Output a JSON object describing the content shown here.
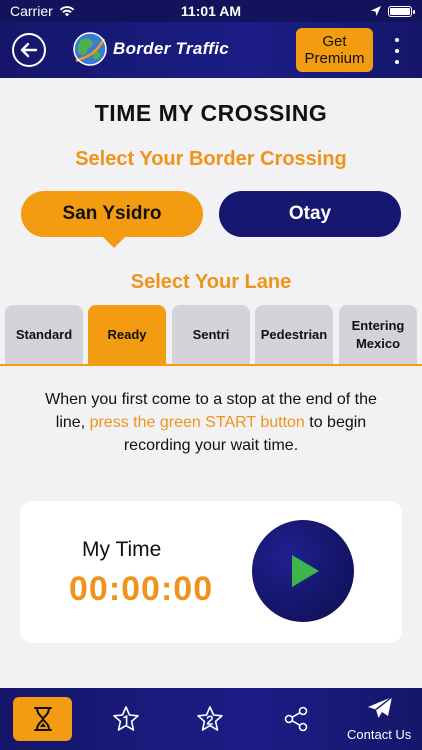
{
  "status_bar": {
    "carrier": "Carrier",
    "time": "11:01 AM"
  },
  "header": {
    "title": "Border Traffic",
    "premium_label_line1": "Get",
    "premium_label_line2": "Premium"
  },
  "page": {
    "title": "TIME MY CROSSING",
    "crossing_section_title": "Select Your Border Crossing",
    "lane_section_title": "Select Your Lane"
  },
  "crossings": [
    {
      "label": "San Ysidro",
      "selected": true
    },
    {
      "label": "Otay",
      "selected": false
    }
  ],
  "lanes": [
    {
      "label": "Standard",
      "selected": false
    },
    {
      "label": "Ready",
      "selected": true
    },
    {
      "label": "Sentri",
      "selected": false
    },
    {
      "label": "Pedestrian",
      "selected": false
    },
    {
      "label_line1": "Entering",
      "label_line2": "Mexico",
      "selected": false
    }
  ],
  "instructions": {
    "part1": "When you first come to a stop at the end of the line, ",
    "highlight": "press the green START button",
    "part2": " to begin recording your wait time."
  },
  "timer": {
    "label": "My Time",
    "value": "00:00:00"
  },
  "bottom_nav": {
    "contact_label": "Contact Us"
  },
  "colors": {
    "navy": "#15166a",
    "accent": "#f39c12",
    "start_green": "#3cb54a"
  }
}
